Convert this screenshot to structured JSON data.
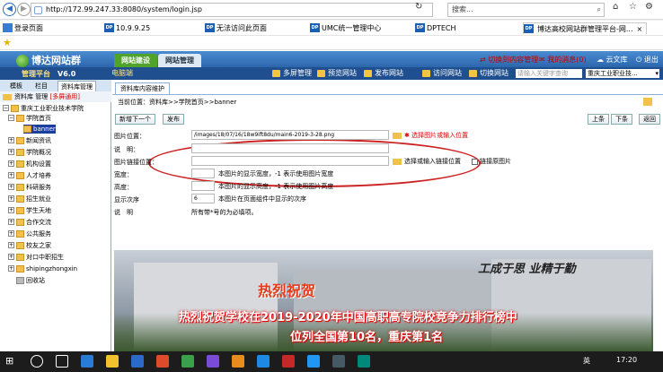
{
  "browser": {
    "url": "http://172.99.247.33:8080/system/login.jsp",
    "search_placeholder": "搜索...",
    "favorites": [
      {
        "label": "登录页面"
      },
      {
        "label": "10.9.9.25"
      },
      {
        "label": "无法访问此页面"
      },
      {
        "label": "UMC统一管理中心"
      },
      {
        "label": "DPTECH"
      }
    ],
    "active_tab": "博达高校网站群管理平台-网...",
    "favicon_text": "DP"
  },
  "app": {
    "brand": "博达网站群",
    "brand_sub": "管理平台",
    "version": "V6.0",
    "main_tabs": [
      {
        "label": "网站建设"
      },
      {
        "label": "网站管理"
      }
    ],
    "top_links": {
      "switch_content": "切换到内容管理",
      "my_messages": "我的消息(0)",
      "cloud_library": "云文库",
      "logout": "退出"
    },
    "sub_title": "电脑端",
    "toolbar": [
      {
        "label": "多屏管理"
      },
      {
        "label": "预览网站"
      },
      {
        "label": "发布网站"
      },
      {
        "label": "访问网站"
      },
      {
        "label": "切换网站"
      }
    ],
    "keyword_placeholder": "请输入关键字查询",
    "site_select": "重庆工业职业技..."
  },
  "sidebar": {
    "tabs": [
      {
        "label": "模板"
      },
      {
        "label": "栏目"
      },
      {
        "label": "资料库管理"
      }
    ],
    "header": "资料库 管理",
    "header_tag": "[多屏通用]",
    "tree": [
      {
        "label": "重庆工业职业技术学院"
      },
      {
        "label": "学院首页"
      },
      {
        "label": "banner"
      },
      {
        "label": "新闻资讯"
      },
      {
        "label": "学院概况"
      },
      {
        "label": "机构设置"
      },
      {
        "label": "人才培养"
      },
      {
        "label": "科研服务"
      },
      {
        "label": "招生就业"
      },
      {
        "label": "学生天地"
      },
      {
        "label": "合作交流"
      },
      {
        "label": "公共服务"
      },
      {
        "label": "校友之家"
      },
      {
        "label": "对口中职招生"
      },
      {
        "label": "shipingzhongxin"
      },
      {
        "label": "回收站"
      }
    ]
  },
  "content": {
    "tab": "资料库内容维护",
    "breadcrumb": "当前位置：资料库>>学院首页>>banner",
    "buttons": {
      "add_next": "新增下一个",
      "publish": "发布",
      "prev": "上条",
      "next": "下条",
      "back": "返回"
    },
    "fields": {
      "image_pos_label": "图片位置：",
      "image_pos_value": "/images/18/07/16/18w9ift8du/main6-2019-3-28.png",
      "image_pos_hint": "选择图片或输入位置",
      "desc_label": "说　明：",
      "desc_value": "",
      "link_label": "图片链接位置：",
      "link_value": "",
      "link_hint": "选择或输入链接位置",
      "link_checkbox": "链接原图片",
      "width_label": "宽度：",
      "width_value": "",
      "width_hint": "本图片的显示宽度，-1 表示使用图片宽度",
      "height_label": "高度：",
      "height_value": "",
      "height_hint": "本图片的显示高度，-1 表示使用图片高度",
      "order_label": "显示次序",
      "order_value": "6",
      "order_hint": "本图片在页面组件中显示的次序",
      "note_label": "说　明",
      "note_value": "所有带*号的为必填项。"
    },
    "banner": {
      "calligraphy": "工成于思 业精于勤",
      "congrats": "热烈祝贺",
      "line1": "热烈祝贺学校在2019-2020年中国高职高专院校竞争力排行榜中",
      "line2": "位列全国第10名，重庆第1名"
    }
  },
  "taskbar": {
    "lang": "英",
    "time": "17:20"
  }
}
